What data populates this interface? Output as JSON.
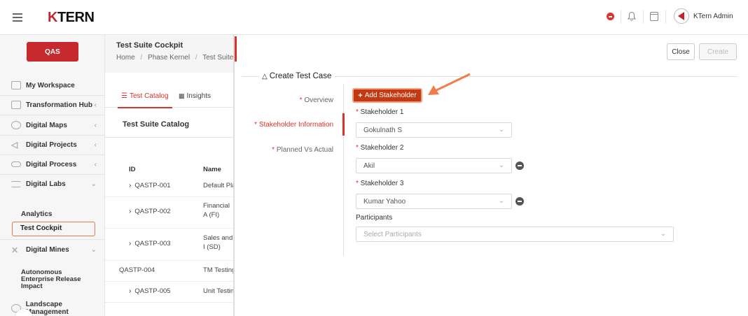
{
  "brand": {
    "logo_k": "K",
    "logo_rest": "TERN"
  },
  "header": {
    "user_name": "KTern Admin"
  },
  "sidebar": {
    "workspace_badge": "QAS",
    "items": [
      {
        "label": "My Workspace",
        "icon": "workspace-icon"
      },
      {
        "label": "Transformation Hub",
        "icon": "grid-icon"
      },
      {
        "label": "Digital Maps",
        "icon": "map-icon"
      },
      {
        "label": "Digital Projects",
        "icon": "send-icon"
      },
      {
        "label": "Digital Process",
        "icon": "process-icon"
      },
      {
        "label": "Digital Labs",
        "icon": "labs-icon"
      },
      {
        "label": "Digital Mines",
        "icon": "mines-icon"
      },
      {
        "label": "Landscape Management",
        "icon": "landscape-icon"
      }
    ],
    "labs_sub": {
      "analytics": "Analytics",
      "test_cockpit": "Test Cockpit"
    },
    "mines_sub": {
      "autonomous": "Autonomous Enterprise Release Impact"
    }
  },
  "suite": {
    "title": "Test Suite Cockpit",
    "breadcrumb": [
      "Home",
      "Phase Kernel",
      "Test Suite"
    ],
    "tabs": {
      "catalog": "Test Catalog",
      "insights": "Insights"
    },
    "catalog_title": "Test Suite Catalog",
    "columns": {
      "id": "ID",
      "name": "Name"
    },
    "rows": [
      {
        "id": "QASTP-001",
        "name": "Default Pla"
      },
      {
        "id": "QASTP-002",
        "name": "Financial A (FI)"
      },
      {
        "id": "QASTP-003",
        "name": "Sales and I (SD)"
      },
      {
        "id": "QASTP-004",
        "name": "TM Testing"
      },
      {
        "id": "QASTP-005",
        "name": "Unit Testin"
      }
    ]
  },
  "drawer": {
    "buttons": {
      "close": "Close",
      "create": "Create"
    },
    "section_title": "Create Test Case",
    "steps": {
      "overview": "Overview",
      "stakeholder_info": "Stakeholder Information",
      "planned_actual": "Planned Vs Actual"
    },
    "add_stakeholder": "Add Stakeholder",
    "stakeholders": [
      {
        "label": "Stakeholder 1",
        "value": "Gokulnath S"
      },
      {
        "label": "Stakeholder 2",
        "value": "Akil"
      },
      {
        "label": "Stakeholder 3",
        "value": "Kumar Yahoo"
      }
    ],
    "participants": {
      "label": "Participants",
      "placeholder": "Select Participants"
    }
  },
  "colors": {
    "brand_red": "#c62a2f",
    "accent_orange": "#e07b4f",
    "button_dark_orange": "#c33a12"
  }
}
